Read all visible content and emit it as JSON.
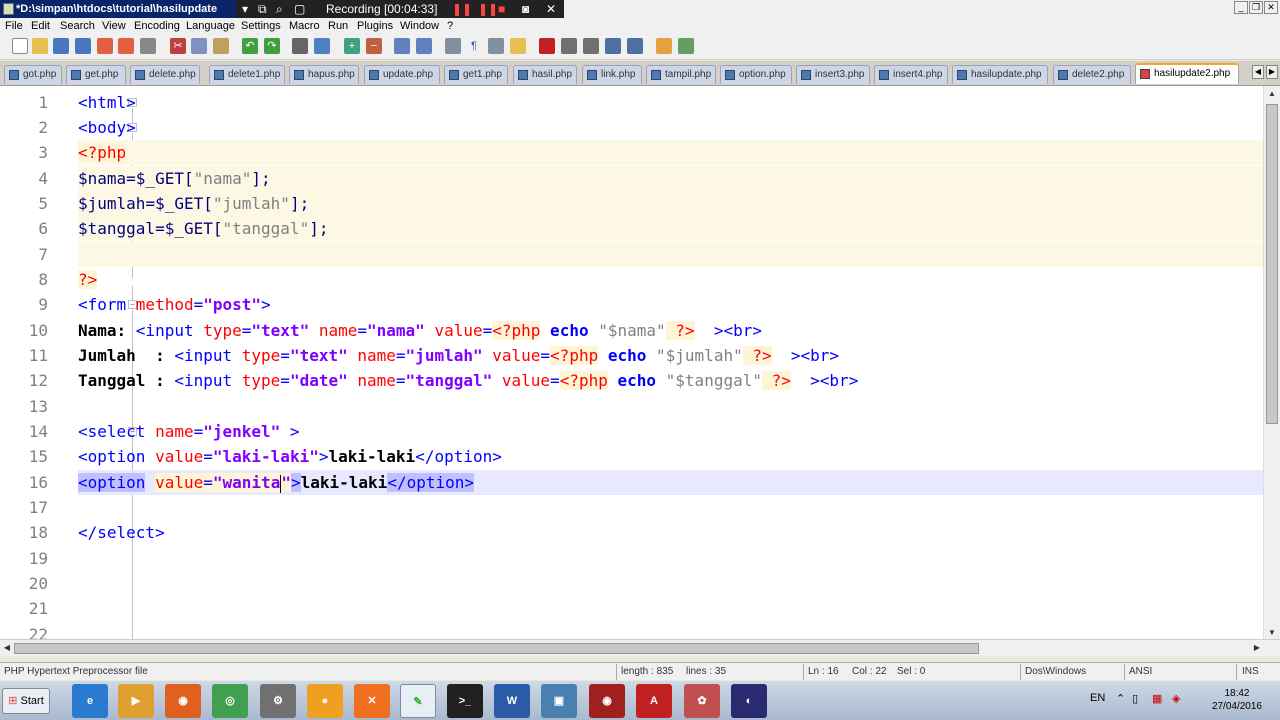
{
  "window": {
    "title": "*D:\\simpan\\htdocs\\tutorial\\hasilupdate",
    "recording": "Recording [00:04:33]"
  },
  "menu": [
    "File",
    "Edit",
    "Search",
    "View",
    "Encoding",
    "Language",
    "Settings",
    "Macro",
    "Run",
    "Plugins",
    "Window",
    "?"
  ],
  "tabs": [
    "got.php",
    "get.php",
    "delete.php",
    "delete1.php",
    "hapus.php",
    "update.php",
    "get1.php",
    "hasil.php",
    "link.php",
    "tampil.php",
    "option.php",
    "insert3.php",
    "insert4.php",
    "hasilupdate.php",
    "delete2.php",
    "hasilupdate2.php"
  ],
  "active_tab": "hasilupdate2.php",
  "line_numbers": [
    "1",
    "2",
    "3",
    "4",
    "5",
    "6",
    "7",
    "8",
    "9",
    "10",
    "11",
    "12",
    "13",
    "14",
    "15",
    "16",
    "17",
    "18",
    "19",
    "20",
    "21",
    "22"
  ],
  "code": {
    "l1": "<html>",
    "l2": "<body>",
    "l3": "<?php",
    "l4a": "$nama",
    "l4b": "=$_GET[",
    "l4c": "\"nama\"",
    "l4d": "];",
    "l5a": "$jumlah",
    "l5b": "=$_GET[",
    "l5c": "\"jumlah\"",
    "l5d": "];",
    "l6a": "$tanggal",
    "l6b": "=$_GET[",
    "l6c": "\"tanggal\"",
    "l6d": "];",
    "l8": "?>",
    "l9a": "<form ",
    "l9b": "method",
    "l9c": "=",
    "l9d": "\"post\"",
    "l9e": ">",
    "l10a": "Nama: ",
    "l10b": "<input ",
    "l10c": "type",
    "l10d": "=",
    "l10e": "\"text\"",
    "l10f": " name",
    "l10g": "=",
    "l10h": "\"nama\"",
    "l10i": " value",
    "l10j": "=",
    "l10k": "<?php",
    "l10l": " echo ",
    "l10m": "\"$nama\"",
    "l10n": " ?>",
    "l10o": "  ><br>",
    "l11a": "Jumlah  : ",
    "l11b": "<input ",
    "l11c": "type",
    "l11d": "=",
    "l11e": "\"text\"",
    "l11f": " name",
    "l11g": "=",
    "l11h": "\"jumlah\"",
    "l11i": " value",
    "l11j": "=",
    "l11k": "<?php",
    "l11l": " echo ",
    "l11m": "\"$jumlah\"",
    "l11n": " ?>",
    "l11o": "  ><br>",
    "l12a": "Tanggal : ",
    "l12b": "<input ",
    "l12c": "type",
    "l12d": "=",
    "l12e": "\"date\"",
    "l12f": " name",
    "l12g": "=",
    "l12h": "\"tanggal\"",
    "l12i": " value",
    "l12j": "=",
    "l12k": "<?php",
    "l12l": " echo ",
    "l12m": "\"$tanggal\"",
    "l12n": " ?>",
    "l12o": "  ><br>",
    "l14a": "<select ",
    "l14b": "name",
    "l14c": "=",
    "l14d": "\"jenkel\"",
    "l14e": " >",
    "l15a": "<option ",
    "l15b": "value",
    "l15c": "=",
    "l15d": "\"laki-laki\"",
    "l15e": ">",
    "l15f": "laki-laki",
    "l15g": "</option>",
    "l16a": "<option",
    "l16b": " ",
    "l16c": "value",
    "l16d": "=",
    "l16e": "\"wanita",
    "l16f": "\"",
    "l16g": ">",
    "l16h": "laki-laki",
    "l16i": "</option>",
    "l18": "</select>"
  },
  "status": {
    "file_type": "PHP Hypertext Preprocessor file",
    "length": "length : 835",
    "lines": "lines : 35",
    "ln": "Ln : 16",
    "col": "Col : 22",
    "sel": "Sel : 0",
    "eol": "Dos\\Windows",
    "encoding": "ANSI",
    "mode": "INS"
  },
  "taskbar": {
    "start": "Start",
    "lang": "EN",
    "time": "18:42",
    "date": "27/04/2016"
  },
  "icons": [
    "notepadpp-icon",
    "new-file-icon",
    "open-icon",
    "save-icon",
    "ie-icon",
    "firefox-icon",
    "chrome-icon",
    "xampp-icon",
    "cmd-icon",
    "word-icon",
    "pdf-icon",
    "eclipse-icon"
  ]
}
